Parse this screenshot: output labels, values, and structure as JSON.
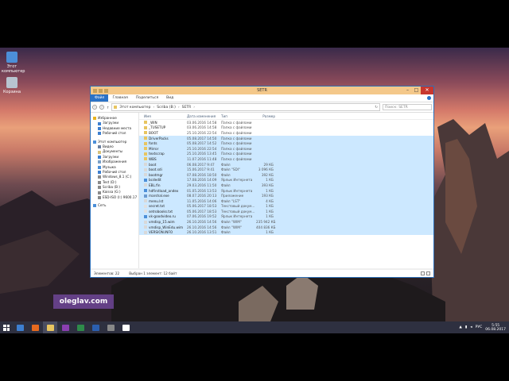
{
  "window": {
    "title": "SETR",
    "controls": {
      "minimize": "–",
      "maximize": "□",
      "close": "✕"
    }
  },
  "ribbon": {
    "file": "Файл",
    "tabs": [
      "Главная",
      "Поделиться",
      "Вид"
    ]
  },
  "address": {
    "crumbs": [
      "Этот компьютер",
      "Scriba (B:)",
      "SETR"
    ],
    "search_placeholder": "Поиск: SETR"
  },
  "desktop": {
    "icons": [
      {
        "label": "Этот компьютер",
        "icon": "computer-icon"
      },
      {
        "label": "Корзина",
        "icon": "recycle-bin-icon"
      }
    ]
  },
  "navpane": {
    "items": [
      {
        "label": "Избранное",
        "level": "top",
        "icon": "star-icon",
        "color": "#e8b320"
      },
      {
        "label": "Загрузки",
        "level": "sub",
        "icon": "downloads-icon",
        "color": "#3d7fd0"
      },
      {
        "label": "Недавние места",
        "level": "sub",
        "icon": "recent-icon",
        "color": "#3d7fd0"
      },
      {
        "label": "Рабочий стол",
        "level": "sub",
        "icon": "desktop-icon",
        "color": "#3d7fd0"
      },
      {
        "label": "Этот компьютер",
        "level": "top",
        "icon": "computer-icon",
        "color": "#4c8fd8",
        "gap": true
      },
      {
        "label": "Видео",
        "level": "sub",
        "icon": "video-icon",
        "color": "#6a7fa0"
      },
      {
        "label": "Документы",
        "level": "sub",
        "icon": "documents-icon",
        "color": "#d8c27a"
      },
      {
        "label": "Загрузки",
        "level": "sub",
        "icon": "downloads-icon",
        "color": "#3d7fd0"
      },
      {
        "label": "Изображения",
        "level": "sub",
        "icon": "pictures-icon",
        "color": "#7aa0c8"
      },
      {
        "label": "Музыка",
        "level": "sub",
        "icon": "music-icon",
        "color": "#4c8fd8"
      },
      {
        "label": "Рабочий стол",
        "level": "sub",
        "icon": "desktop-icon",
        "color": "#3d7fd0"
      },
      {
        "label": "Windows_8.1 (C:)",
        "level": "sub",
        "icon": "drive-icon",
        "color": "#8a8a8a"
      },
      {
        "label": "Test (D:)",
        "level": "sub",
        "icon": "drive-icon",
        "color": "#8a8a8a"
      },
      {
        "label": "Scriba (B:)",
        "level": "sub",
        "icon": "drive-icon",
        "color": "#8a8a8a"
      },
      {
        "label": "Kaissa (G:)",
        "level": "sub",
        "icon": "drive-icon",
        "color": "#8a8a8a"
      },
      {
        "label": "ESD-ISO (I:) 9600.17",
        "level": "sub",
        "icon": "dvd-icon",
        "color": "#8a8a8a"
      },
      {
        "label": "Сеть",
        "level": "top",
        "icon": "network-icon",
        "color": "#4c8fd8",
        "gap": true
      }
    ]
  },
  "columns": {
    "name": "Имя",
    "date": "Дата изменения",
    "type": "Тип",
    "size": "Размер"
  },
  "files": [
    {
      "name": "_WIN",
      "date": "03.06.2016 14:58",
      "type": "Папка с файлами",
      "size": "",
      "kind": "folder",
      "selected": false
    },
    {
      "name": "_TUSETUP",
      "date": "03.06.2016 14:58",
      "type": "Папка с файлами",
      "size": "",
      "kind": "folder",
      "selected": false
    },
    {
      "name": "BOOT",
      "date": "25.10.2016 22:54",
      "type": "Папка с файлами",
      "size": "",
      "kind": "folder",
      "selected": false
    },
    {
      "name": "DriverPacks",
      "date": "05.08.2017 14:50",
      "type": "Папка с файлами",
      "size": "",
      "kind": "folder",
      "selected": true
    },
    {
      "name": "fonts",
      "date": "05.08.2017 14:52",
      "type": "Папка с файлами",
      "size": "",
      "kind": "folder",
      "selected": true
    },
    {
      "name": "Mirror",
      "date": "25.10.2016 22:54",
      "type": "Папка с файлами",
      "size": "",
      "kind": "folder",
      "selected": true
    },
    {
      "name": "textscrap",
      "date": "25.10.2016 13:45",
      "type": "Папка с файлами",
      "size": "",
      "kind": "folder",
      "selected": true
    },
    {
      "name": "WBS",
      "date": "11.07.2016 11:48",
      "type": "Папка с файлами",
      "size": "",
      "kind": "folder",
      "selected": true
    },
    {
      "name": "boot",
      "date": "06.08.2017 9:47",
      "type": "Файл",
      "size": "29 КБ",
      "kind": "file",
      "selected": true
    },
    {
      "name": "boot.sdi",
      "date": "15.06.2017 9:41",
      "type": "Файл \"SDI\"",
      "size": "3 096 КБ",
      "kind": "file",
      "selected": true
    },
    {
      "name": "bootmgr",
      "date": "07.08.2016 18:50",
      "type": "Файл",
      "size": "392 КБ",
      "kind": "file",
      "selected": true
    },
    {
      "name": "bcdedit",
      "date": "17.08.2016 14:09",
      "type": "Ярлык Интернета",
      "size": "1 КБ",
      "kind": "link",
      "selected": true
    },
    {
      "name": "EBL.fin",
      "date": "29.03.2016 11:50",
      "type": "Файл",
      "size": "393 КБ",
      "kind": "file",
      "selected": true
    },
    {
      "name": "hdfirstload_andex",
      "date": "01.05.2016 13:53",
      "type": "Ярлык Интернета",
      "size": "1 КБ",
      "kind": "link",
      "selected": true
    },
    {
      "name": "marshal.exe",
      "date": "08.07.2016 20:13",
      "type": "Приложение",
      "size": "193 КБ",
      "kind": "app",
      "selected": true
    },
    {
      "name": "menu.lst",
      "date": "11.05.2016 14:06",
      "type": "Файл \"LST\"",
      "size": "4 КБ",
      "kind": "file",
      "selected": true
    },
    {
      "name": "secret.txt",
      "date": "05.06.2017 18:53",
      "type": "Текстовый докум...",
      "size": "1 КБ",
      "kind": "txt",
      "selected": true
    },
    {
      "name": "setrobooks.txt",
      "date": "05.06.2017 18:53",
      "type": "Текстовый докум...",
      "size": "1 КБ",
      "kind": "txt",
      "selected": true
    },
    {
      "name": "vk-goodvideo.ru",
      "date": "07.06.2016 19:52",
      "type": "Ярлык Интернета",
      "size": "1 КБ",
      "kind": "link",
      "selected": true
    },
    {
      "name": "vmdisp_15.wim",
      "date": "26.10.2016 14:56",
      "type": "Файл \"WIM\"",
      "size": "235 942 КБ",
      "kind": "file",
      "selected": true
    },
    {
      "name": "vmdisp_WinEdu.wim",
      "date": "26.10.2016 14:56",
      "type": "Файл \"WIM\"",
      "size": "404 836 КБ",
      "kind": "file",
      "selected": true
    },
    {
      "name": "VERSION.INFO",
      "date": "26.10.2016 13:51",
      "type": "Файл",
      "size": "1 КБ",
      "kind": "file",
      "selected": true
    }
  ],
  "status": {
    "count": "Элементов: 22",
    "selected": "Выбран 1 элемент: 12 байт"
  },
  "watermark": "oleglav.com",
  "taskbar": {
    "apps": [
      {
        "name": "ie-icon",
        "color": "#3d7fd0",
        "active": false
      },
      {
        "name": "firefox-icon",
        "color": "#e66a1f",
        "active": false
      },
      {
        "name": "explorer-icon",
        "color": "#e8c560",
        "active": true
      },
      {
        "name": "media-icon",
        "color": "#8a3fb0",
        "active": false
      },
      {
        "name": "excel-icon",
        "color": "#2e8b4a",
        "active": false
      },
      {
        "name": "word-icon",
        "color": "#2b5fb0",
        "active": false
      },
      {
        "name": "app-icon",
        "color": "#888888",
        "active": false
      },
      {
        "name": "app2-icon",
        "color": "#ffffff",
        "active": false
      }
    ],
    "lang": "РУС",
    "time": "5:55",
    "date": "06.08.2017"
  }
}
